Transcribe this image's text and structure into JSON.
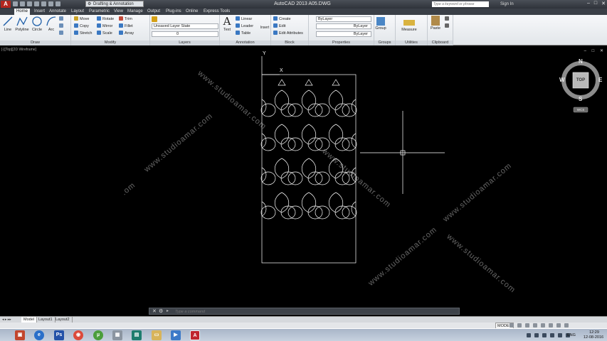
{
  "titlebar": {
    "app_logo": "A",
    "workspace": "Drafting & Annotation",
    "title": "AutoCAD 2013    A05.DWG",
    "search_placeholder": "Type a keyword or phrase",
    "sign_in": "Sign In",
    "controls": [
      "–",
      "□",
      "✕"
    ]
  },
  "tabs": [
    "Home",
    "Insert",
    "Annotate",
    "Layout",
    "Parametric",
    "View",
    "Manage",
    "Output",
    "Plug-ins",
    "Online",
    "Express Tools"
  ],
  "ribbon": {
    "draw": {
      "title": "Draw",
      "buttons": [
        "Line",
        "Polyline",
        "Circle",
        "Arc"
      ]
    },
    "modify": {
      "title": "Modify",
      "buttons": [
        "Move",
        "Rotate",
        "Trim",
        "Copy",
        "Mirror",
        "Fillet",
        "Stretch",
        "Scale",
        "Array"
      ]
    },
    "layers": {
      "title": "Layers",
      "layer_state": "Unsaved Layer State",
      "current_layer": "0"
    },
    "annotation": {
      "title": "Annotation",
      "text": "Text",
      "buttons": [
        "Linear",
        "Leader",
        "Table"
      ]
    },
    "block": {
      "title": "Block",
      "insert": "Insert",
      "buttons": [
        "Create",
        "Edit",
        "Edit Attributes"
      ]
    },
    "properties": {
      "title": "Properties",
      "color": "ByLayer",
      "linetype": "ByLayer",
      "lineweight": "ByLayer"
    },
    "groups": {
      "title": "Groups",
      "group": "Group"
    },
    "utilities": {
      "title": "Utilities",
      "measure": "Measure"
    },
    "clipboard": {
      "title": "Clipboard",
      "paste": "Paste"
    }
  },
  "drawing": {
    "viewport_label": "[-][Top][2D Wireframe]",
    "viewport_controls": "– □ ✕",
    "ucs_y": "Y",
    "ucs_x": "X",
    "viewcube": {
      "n": "N",
      "s": "S",
      "e": "E",
      "w": "W",
      "face": "TOP",
      "wcs": "WCS"
    },
    "watermark": "www.studioamar.com",
    "watermark_fragment": ".om"
  },
  "command_line": {
    "close": "✕",
    "settings": "⚙",
    "prompt": "▸",
    "placeholder": "Type a command"
  },
  "layout_tabs": {
    "nav": "◂ ▸ ▸▸",
    "tabs": [
      "Model",
      "Layout1",
      "Layout2"
    ]
  },
  "status": {
    "model": "MODEL"
  },
  "taskbar": {
    "lang": "ENG",
    "time": "12:29",
    "date": "12-08-2016"
  },
  "colors": {
    "accent": "#b3261e",
    "background": "#000000",
    "linework": "#ffffff"
  }
}
